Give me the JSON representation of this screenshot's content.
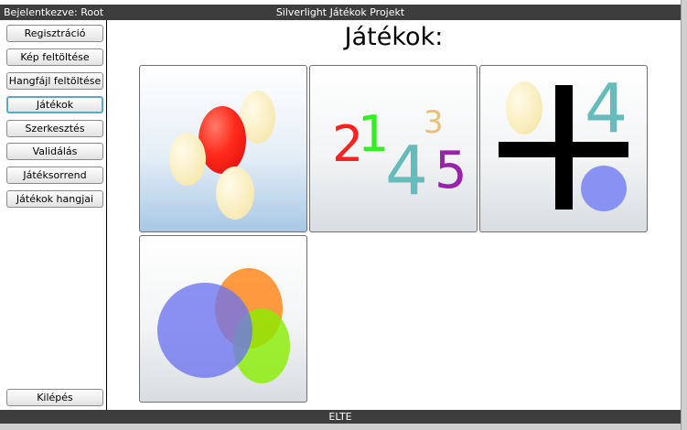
{
  "header": {
    "login_status": "Bejelentkezve: Root",
    "title": "Silverlight Játékok Projekt"
  },
  "sidebar": {
    "items": [
      {
        "label": "Regisztráció"
      },
      {
        "label": "Kép feltöltése"
      },
      {
        "label": "Hangfájl feltöltése"
      },
      {
        "label": "Játékok"
      },
      {
        "label": "Szerkesztés"
      },
      {
        "label": "Validálás"
      },
      {
        "label": "Játéksorrend"
      },
      {
        "label": "Játékok hangjai"
      }
    ],
    "active": "Játékok",
    "logout_label": "Kilépés"
  },
  "main": {
    "title": "Játékok:",
    "tiles": [
      {
        "name": "eggs-game",
        "background": "blue"
      },
      {
        "name": "numbers-game",
        "numbers": [
          "2",
          "1",
          "3",
          "4",
          "5"
        ]
      },
      {
        "name": "plus-game",
        "digit": "4"
      },
      {
        "name": "color-mixing-game"
      }
    ]
  },
  "footer": {
    "text": "ELTE"
  },
  "colors": {
    "bar": "#3d3d3d",
    "active_border": "#5fa6c6",
    "red": "#ff2020",
    "green": "#33ee22",
    "orange": "#e8c07a",
    "teal": "#66bbbb",
    "purple": "#9922aa",
    "periwinkle": "#8892f2"
  }
}
